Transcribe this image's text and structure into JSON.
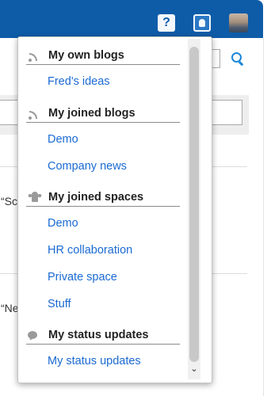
{
  "background": {
    "quote_snippets": [
      "“Sc",
      "“Ne"
    ]
  },
  "menu": {
    "sections": [
      {
        "title": "My own blogs",
        "icon": "feed-icon",
        "items": [
          "Fred's ideas"
        ]
      },
      {
        "title": "My joined blogs",
        "icon": "feed-icon",
        "items": [
          "Demo",
          "Company news"
        ]
      },
      {
        "title": "My joined spaces",
        "icon": "group-icon",
        "items": [
          "Demo",
          "HR collaboration",
          "Private space",
          "Stuff"
        ]
      },
      {
        "title": "My status updates",
        "icon": "chat-bubble-icon",
        "items": [
          "My status updates"
        ]
      }
    ]
  },
  "colors": {
    "topbar": "#0e5ca8",
    "link": "#1a6ad2",
    "accent": "#1a88d8"
  }
}
